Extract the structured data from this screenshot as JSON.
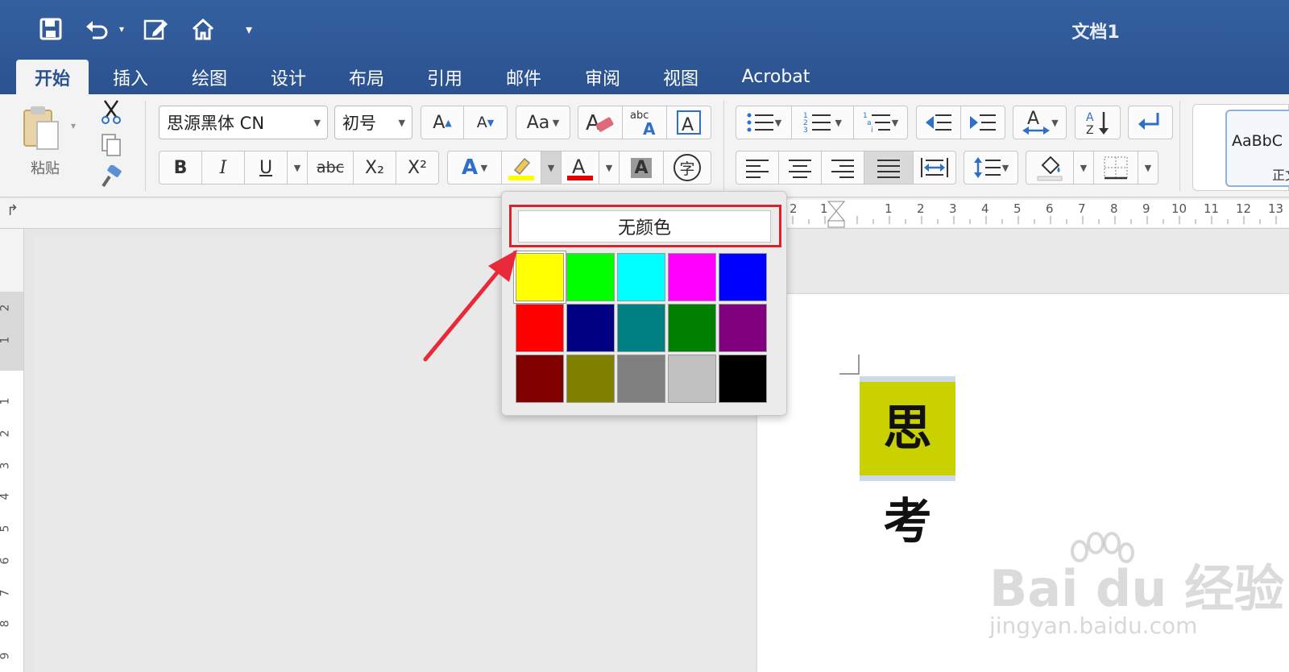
{
  "window": {
    "title": "文档1"
  },
  "tabs": [
    "开始",
    "插入",
    "绘图",
    "设计",
    "布局",
    "引用",
    "邮件",
    "审阅",
    "视图",
    "Acrobat"
  ],
  "clipboard": {
    "paste_label": "粘贴"
  },
  "font": {
    "family": "思源黑体 CN",
    "size": "初号"
  },
  "format_buttons": {
    "bold": "B",
    "italic": "I",
    "underline": "U",
    "strike": "abc",
    "subscript": "X₂",
    "superscript": "X²",
    "char_shade": "A",
    "enclose": "字"
  },
  "font_size_buttons": {
    "grow": "A",
    "shrink": "A"
  },
  "styles": {
    "preview": "AaBbC",
    "name": "正文"
  },
  "highlight_popup": {
    "no_color_label": "无颜色",
    "swatches": [
      "#ffff00",
      "#00ff00",
      "#00ffff",
      "#ff00ff",
      "#0000ff",
      "#ff0000",
      "#000080",
      "#008080",
      "#008000",
      "#800080",
      "#800000",
      "#808000",
      "#808080",
      "#c0c0c0",
      "#000000"
    ],
    "selected_index": 0
  },
  "document": {
    "text": "思考",
    "highlight_color": "#c9d200"
  },
  "ruler": {
    "top_numbers": [
      "2",
      "1",
      "1",
      "2",
      "3",
      "4",
      "5",
      "6",
      "7",
      "8",
      "9",
      "10",
      "11",
      "12",
      "13"
    ],
    "left_numbers": [
      "2",
      "1",
      "1",
      "2",
      "3",
      "4",
      "5",
      "6",
      "7",
      "8",
      "9"
    ]
  },
  "watermark": {
    "brand": "Bai du 经验",
    "url": "jingyan.baidu.com"
  },
  "colors": {
    "accent": "#2b5290",
    "highlight_border": "#d6232c",
    "ribbon_bg": "#f3f3f3"
  }
}
